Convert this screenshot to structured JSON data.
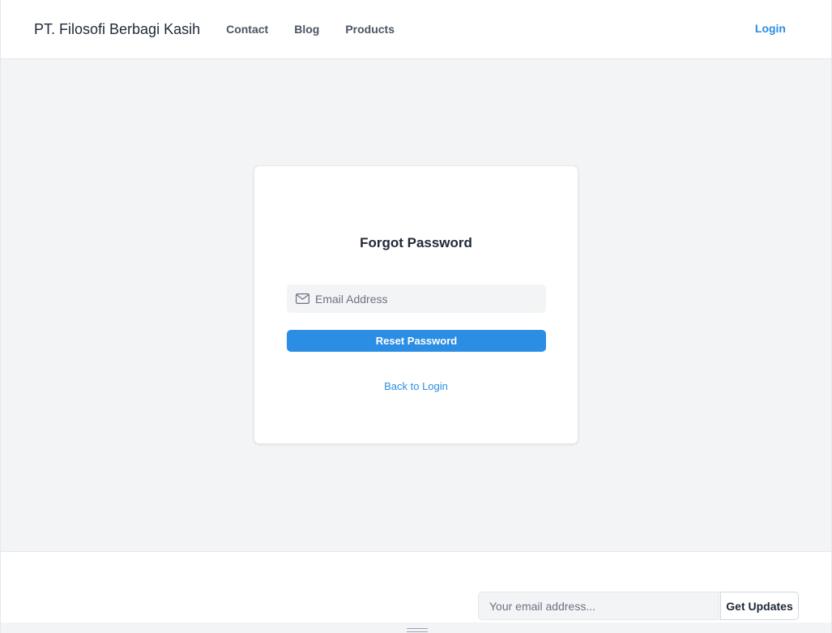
{
  "navbar": {
    "brand": "PT. Filosofi Berbagi Kasih",
    "links": [
      {
        "label": "Contact"
      },
      {
        "label": "Blog"
      },
      {
        "label": "Products"
      }
    ],
    "login_label": "Login"
  },
  "forgot_password": {
    "title": "Forgot Password",
    "email_placeholder": "Email Address",
    "email_value": "",
    "email_icon": "envelope-icon",
    "reset_button_label": "Reset Password",
    "back_link_label": "Back to Login"
  },
  "footer": {
    "subscribe_placeholder": "Your email address...",
    "subscribe_value": "",
    "subscribe_button_label": "Get Updates"
  },
  "colors": {
    "accent": "#2b8de3",
    "page_background": "#f3f4f6",
    "card_background": "#ffffff"
  }
}
